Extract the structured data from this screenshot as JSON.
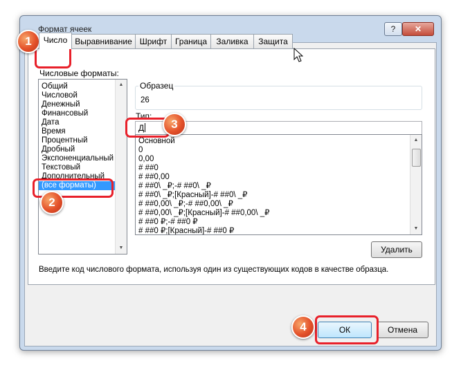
{
  "dialog": {
    "title": "Формат ячеек",
    "help_glyph": "?",
    "close_glyph": "✕"
  },
  "tabs": [
    "Число",
    "Выравнивание",
    "Шрифт",
    "Граница",
    "Заливка",
    "Защита"
  ],
  "number_formats": {
    "label": "Числовые форматы:",
    "items": [
      "Общий",
      "Числовой",
      "Денежный",
      "Финансовый",
      "Дата",
      "Время",
      "Процентный",
      "Дробный",
      "Экспоненциальный",
      "Текстовый",
      "Дополнительный",
      "(все форматы)"
    ],
    "selected": "(все форматы)"
  },
  "sample": {
    "label": "Образец",
    "value": "26"
  },
  "type": {
    "label": "Тип:",
    "value": "Д",
    "items": [
      "Основной",
      "0",
      "0,00",
      "# ##0",
      "# ##0,00",
      "# ##0\\ _₽;-# ##0\\ _₽",
      "# ##0\\ _₽;[Красный]-# ##0\\ _₽",
      "# ##0,00\\ _₽;-# ##0,00\\ _₽",
      "# ##0,00\\ _₽;[Красный]-# ##0,00\\ _₽",
      "# ##0 ₽;-# ##0 ₽",
      "# ##0 ₽;[Красный]-# ##0 ₽"
    ]
  },
  "buttons": {
    "delete": "Удалить",
    "ok": "ОК",
    "cancel": "Отмена"
  },
  "hint": "Введите код числового формата, используя один из существующих кодов в качестве образца.",
  "badges": [
    "1",
    "2",
    "3",
    "4"
  ],
  "colors": {
    "highlight": "#e8202a",
    "badge": "#e4512a",
    "selection": "#3399ff"
  }
}
